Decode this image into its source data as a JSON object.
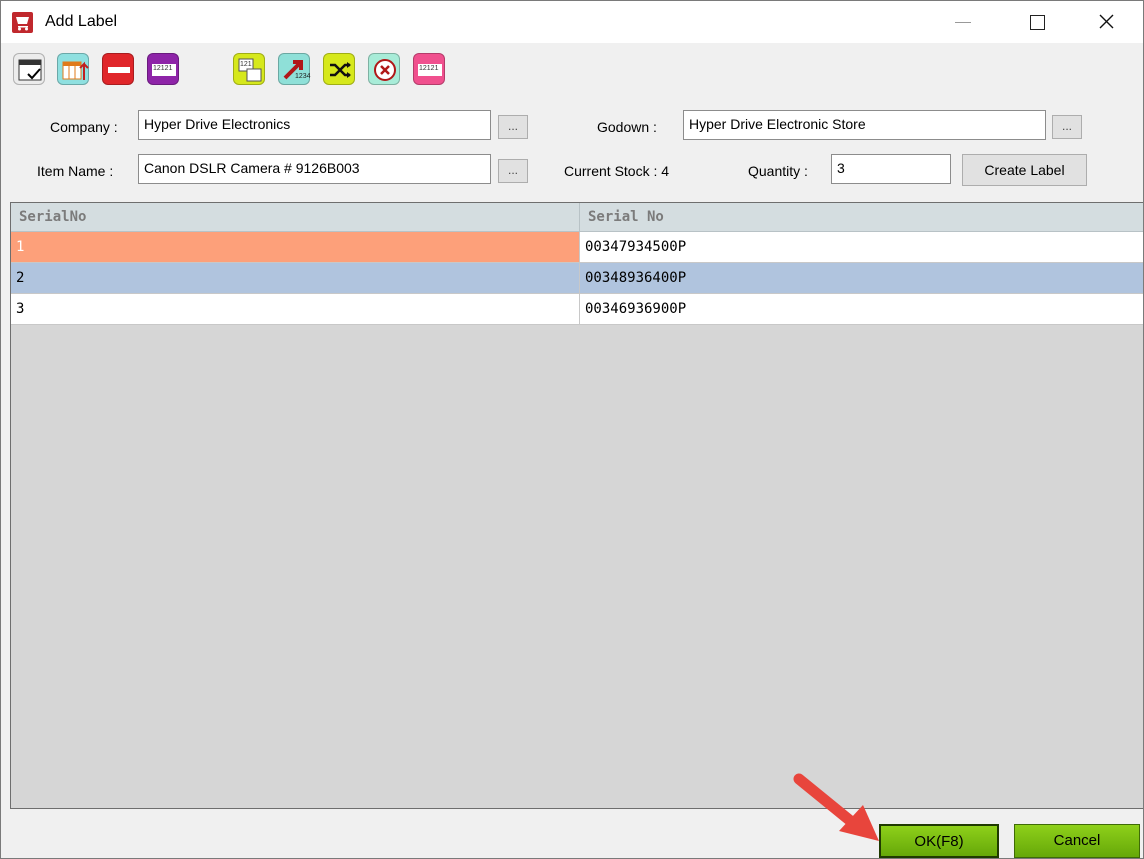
{
  "window": {
    "title": "Add Label",
    "icon": "shopping-cart-icon"
  },
  "toolbar": {
    "icons": [
      "calendar-check-icon",
      "table-export-icon",
      "remove-icon",
      "barcode-label-icon",
      "serial-number-icon",
      "number-arrow-icon",
      "shuffle-icon",
      "cancel-circle-icon",
      "print-label-icon"
    ],
    "serial_icon_text": "121",
    "barcode_icon_text": "12121",
    "arrow_icon_text": "1234"
  },
  "form": {
    "company_label": "Company :",
    "company_value": "Hyper Drive Electronics",
    "godown_label": "Godown :",
    "godown_value": "Hyper Drive Electronic Store",
    "item_label": "Item Name :",
    "item_value": "Canon DSLR Camera # 9126B003",
    "browse_label": "...",
    "current_stock_label": "Current Stock : 4",
    "quantity_label": "Quantity :",
    "quantity_value": "3",
    "create_label_button": "Create Label"
  },
  "grid": {
    "columns": [
      "SerialNo",
      "Serial No"
    ],
    "rows": [
      {
        "index": "1",
        "serial": "00347934500P",
        "highlight": "#fda07a"
      },
      {
        "index": "2",
        "serial": "00348936400P",
        "highlight": "#b0c4de"
      },
      {
        "index": "3",
        "serial": "00346936900P",
        "highlight": "#ffffff"
      }
    ]
  },
  "buttons": {
    "ok": "OK(F8)",
    "cancel": "Cancel"
  },
  "colors": {
    "accent_green": "#7cbf12",
    "annotation_arrow": "#e8453c"
  }
}
